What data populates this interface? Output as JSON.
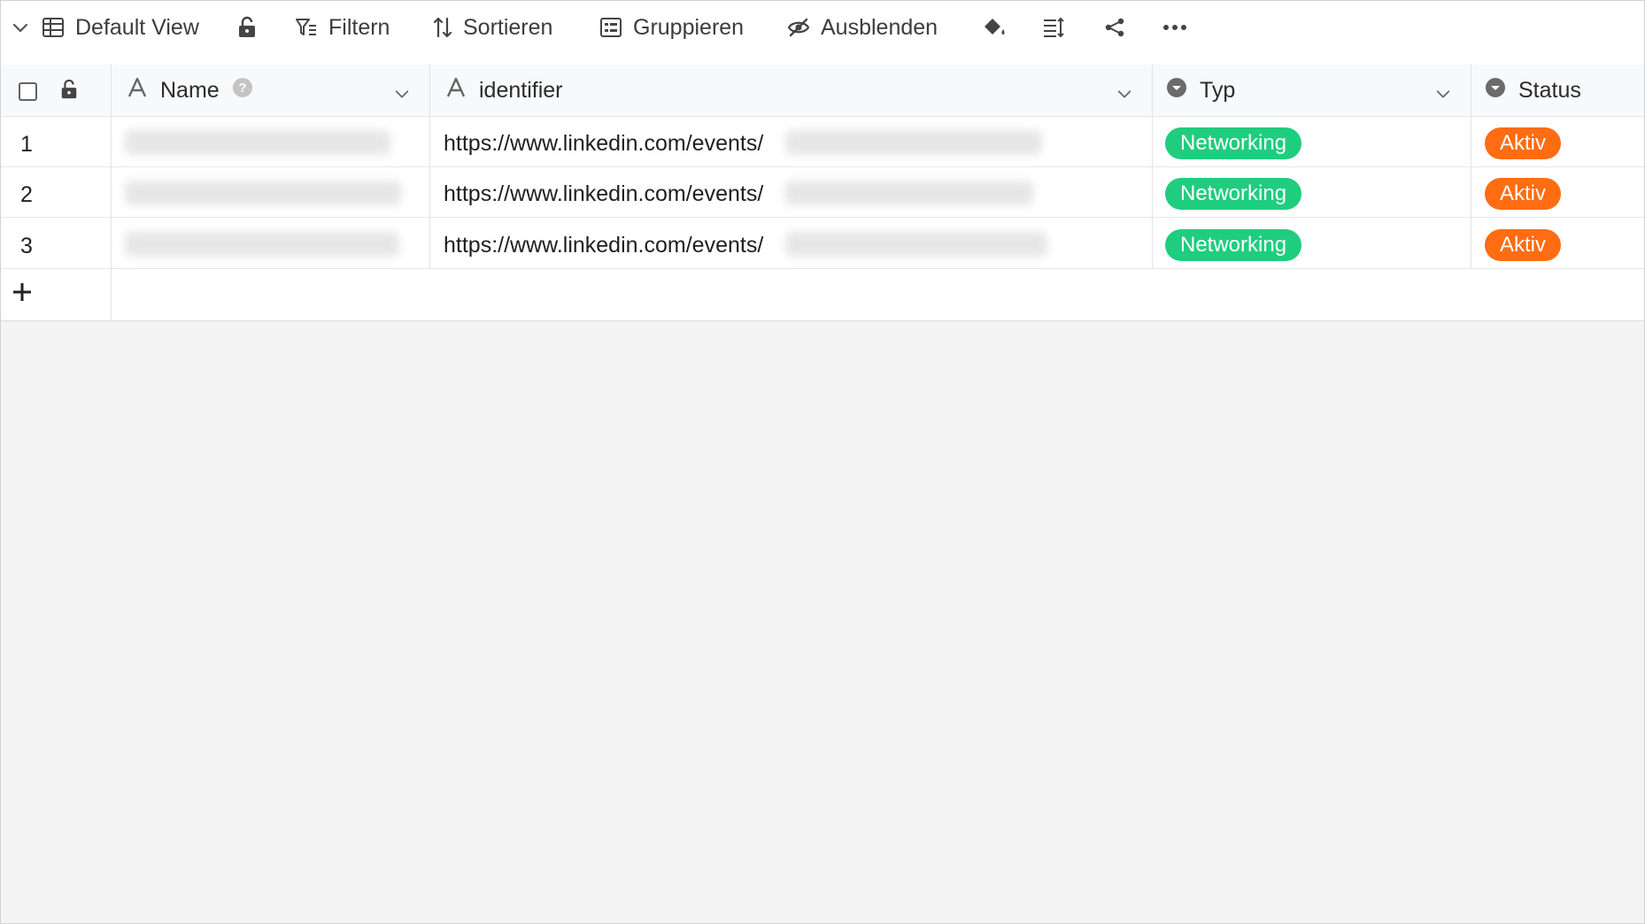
{
  "toolbar": {
    "view_name": "Default View",
    "filter_label": "Filtern",
    "sort_label": "Sortieren",
    "group_label": "Gruppieren",
    "hide_label": "Ausblenden",
    "icons": [
      "chevron-down-icon",
      "table-icon",
      "lock-open-icon",
      "filter-icon",
      "sort-icon",
      "group-icon",
      "eye-off-icon",
      "paint-bucket-icon",
      "row-height-icon",
      "share-icon",
      "more-icon"
    ]
  },
  "columns": [
    {
      "label": "Name",
      "icon": "text-type-icon",
      "has_help": true
    },
    {
      "label": "identifier",
      "icon": "text-type-icon"
    },
    {
      "label": "Typ",
      "icon": "single-select-icon"
    },
    {
      "label": "Status",
      "icon": "single-select-icon"
    }
  ],
  "rows": [
    {
      "num": "1",
      "identifier": "https://www.linkedin.com/events/",
      "typ": "Networking",
      "status": "Aktiv"
    },
    {
      "num": "2",
      "identifier": "https://www.linkedin.com/events/",
      "typ": "Networking",
      "status": "Aktiv"
    },
    {
      "num": "3",
      "identifier": "https://www.linkedin.com/events/",
      "typ": "Networking",
      "status": "Aktiv"
    }
  ],
  "colors": {
    "typ_pill": "#1fcd7e",
    "status_pill": "#ff6c12",
    "background": "#f4f4f4"
  }
}
